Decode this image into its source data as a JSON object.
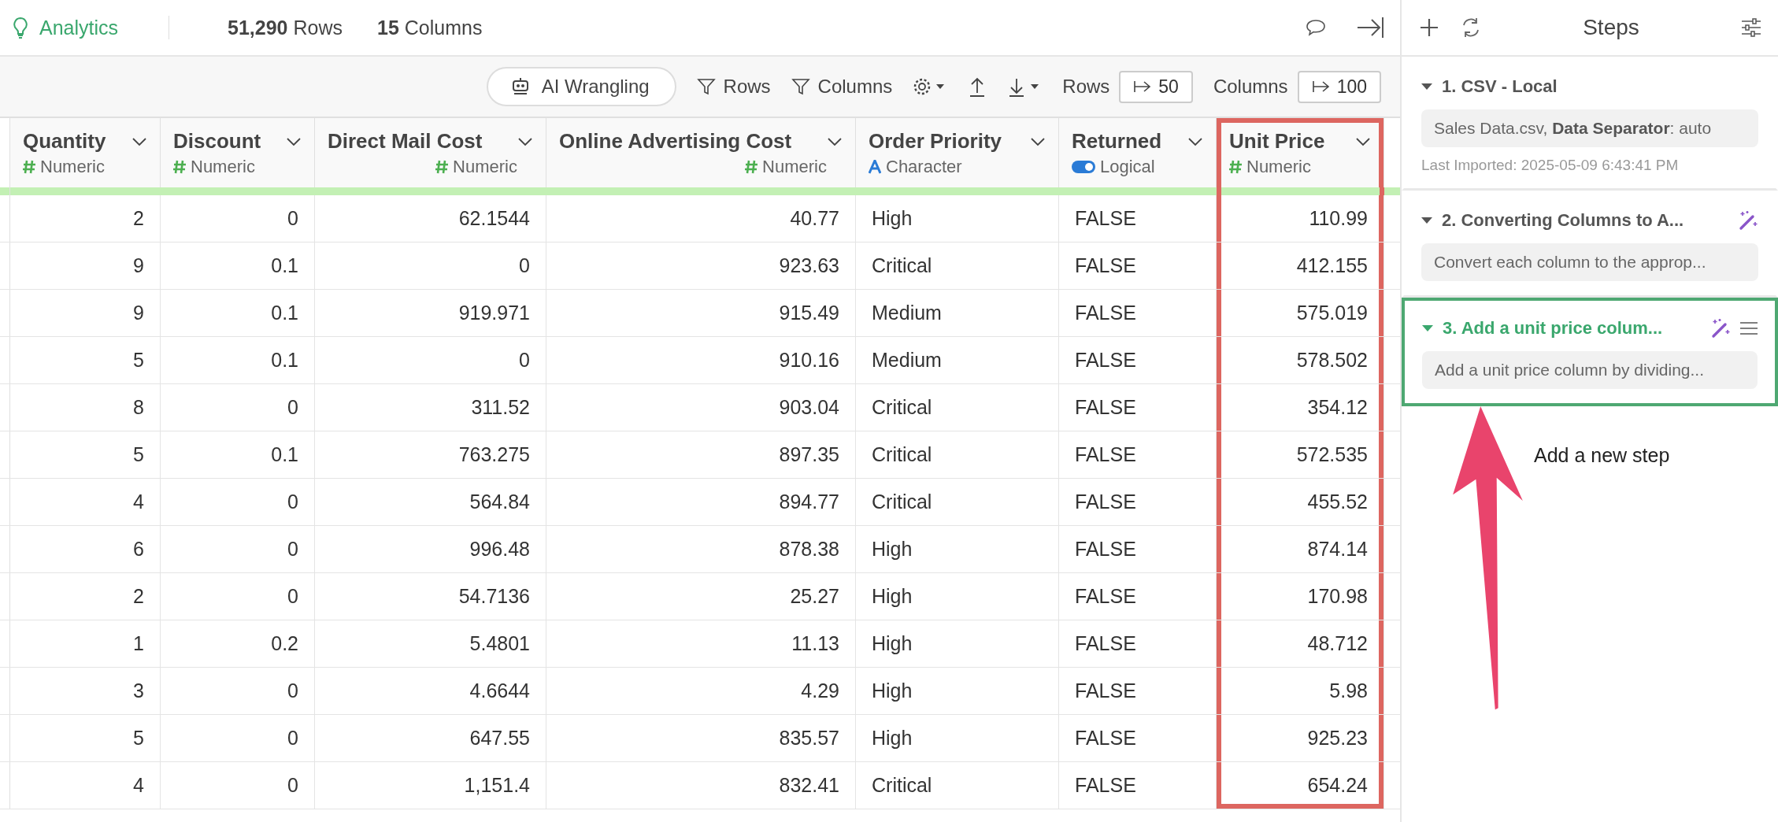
{
  "topbar": {
    "app_name": "Analytics",
    "rows_count": "51,290",
    "rows_label": "Rows",
    "columns_count": "15",
    "columns_label": "Columns"
  },
  "toolbar": {
    "ai_button": "AI Wrangling",
    "rows_filter": "Rows",
    "columns_filter": "Columns",
    "rows_label": "Rows",
    "rows_value": "50",
    "columns_label": "Columns",
    "columns_value": "100"
  },
  "table": {
    "columns": [
      {
        "name": "Quantity",
        "type": "Numeric",
        "kind": "numeric",
        "highlighted": false
      },
      {
        "name": "Discount",
        "type": "Numeric",
        "kind": "numeric",
        "highlighted": false
      },
      {
        "name": "Direct Mail Cost",
        "type": "Numeric",
        "kind": "numeric",
        "highlighted": false
      },
      {
        "name": "Online Advertising Cost",
        "type": "Numeric",
        "kind": "numeric",
        "highlighted": false
      },
      {
        "name": "Order Priority",
        "type": "Character",
        "kind": "character",
        "highlighted": false
      },
      {
        "name": "Returned",
        "type": "Logical",
        "kind": "logical",
        "highlighted": false
      },
      {
        "name": "Unit Price",
        "type": "Numeric",
        "kind": "numeric",
        "highlighted": true
      }
    ],
    "rows": [
      [
        "2",
        "0",
        "62.1544",
        "40.77",
        "High",
        "FALSE",
        "110.99"
      ],
      [
        "9",
        "0.1",
        "0",
        "923.63",
        "Critical",
        "FALSE",
        "412.155"
      ],
      [
        "9",
        "0.1",
        "919.971",
        "915.49",
        "Medium",
        "FALSE",
        "575.019"
      ],
      [
        "5",
        "0.1",
        "0",
        "910.16",
        "Medium",
        "FALSE",
        "578.502"
      ],
      [
        "8",
        "0",
        "311.52",
        "903.04",
        "Critical",
        "FALSE",
        "354.12"
      ],
      [
        "5",
        "0.1",
        "763.275",
        "897.35",
        "Critical",
        "FALSE",
        "572.535"
      ],
      [
        "4",
        "0",
        "564.84",
        "894.77",
        "Critical",
        "FALSE",
        "455.52"
      ],
      [
        "6",
        "0",
        "996.48",
        "878.38",
        "High",
        "FALSE",
        "874.14"
      ],
      [
        "2",
        "0",
        "54.7136",
        "25.27",
        "High",
        "FALSE",
        "170.98"
      ],
      [
        "1",
        "0.2",
        "5.4801",
        "11.13",
        "High",
        "FALSE",
        "48.712"
      ],
      [
        "3",
        "0",
        "4.6644",
        "4.29",
        "High",
        "FALSE",
        "5.98"
      ],
      [
        "5",
        "0",
        "647.55",
        "835.57",
        "High",
        "FALSE",
        "925.23"
      ],
      [
        "4",
        "0",
        "1,151.4",
        "832.41",
        "Critical",
        "FALSE",
        "654.24"
      ]
    ]
  },
  "steps_panel": {
    "title": "Steps",
    "steps": [
      {
        "title": "1. CSV - Local",
        "description": "Sales Data.csv, **Data Separator**: auto",
        "note": "Last Imported: 2025-05-09 6:43:41 PM",
        "ai_generated": false,
        "menu": false,
        "selected": false
      },
      {
        "title": "2. Converting Columns to A...",
        "description": "Convert each column to the approp...",
        "ai_generated": true,
        "menu": false,
        "selected": false
      },
      {
        "title": "3. Add a unit price colum...",
        "description": "Add a unit price column by dividing...",
        "ai_generated": true,
        "menu": true,
        "selected": true
      }
    ],
    "annotation": "Add a new step"
  }
}
